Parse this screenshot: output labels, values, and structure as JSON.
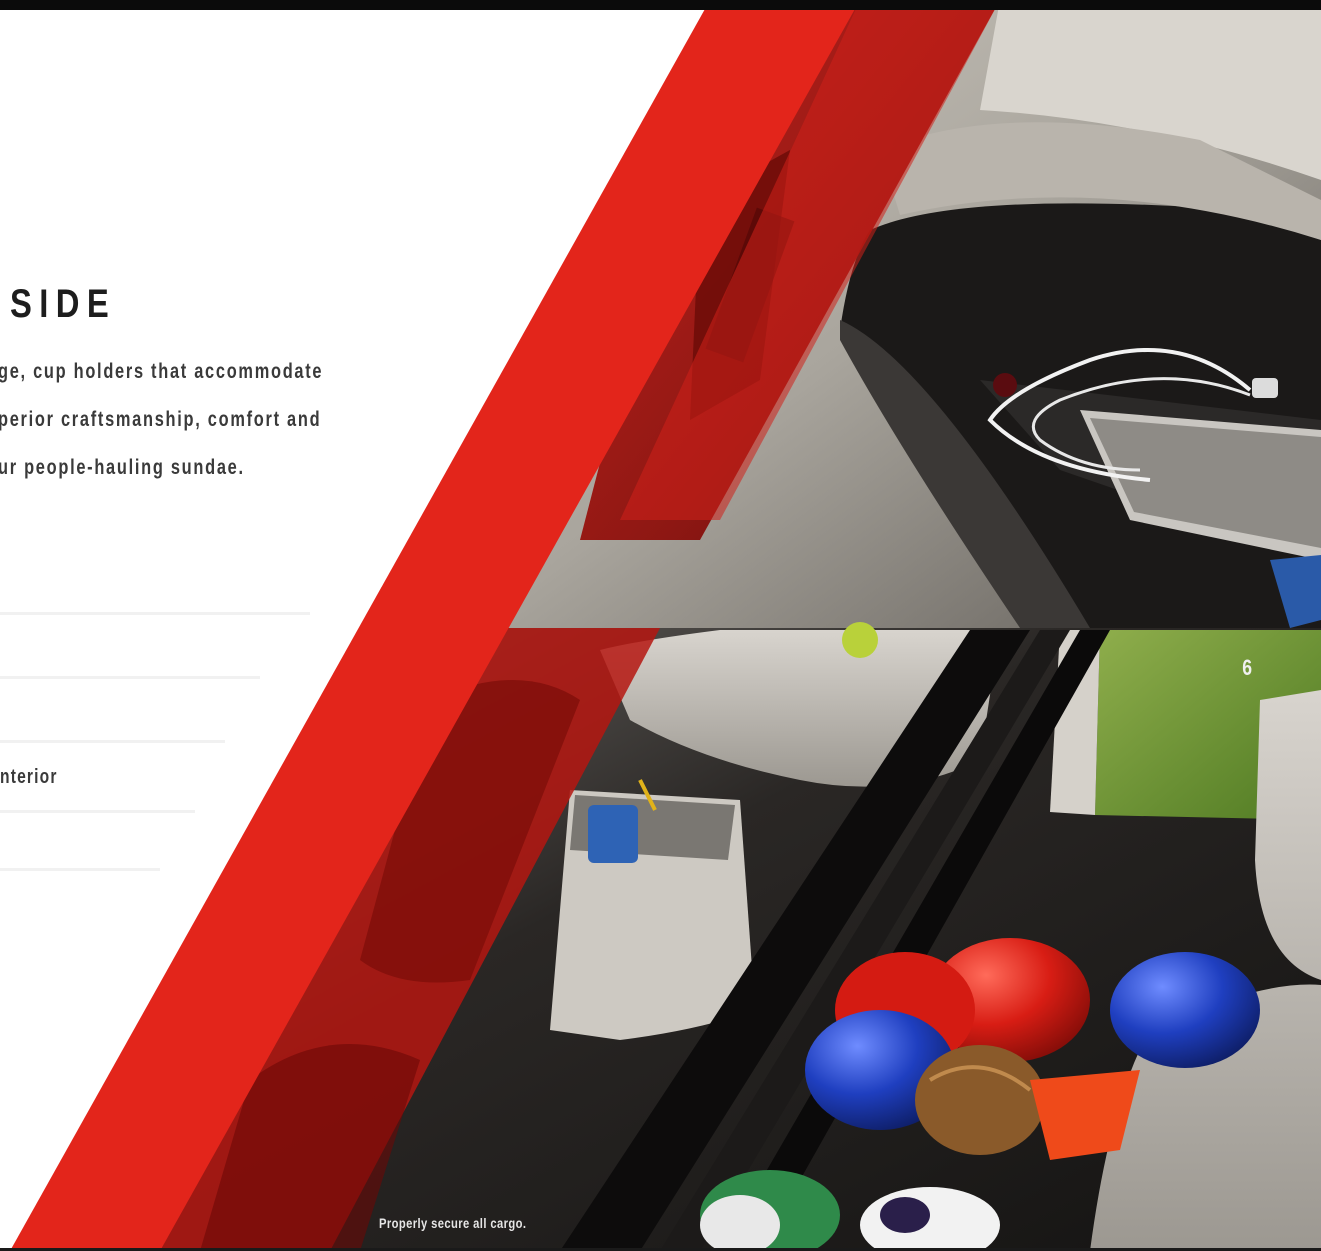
{
  "heading": "SIDE",
  "body_lines": [
    "ge, cup holders that accommodate",
    "perior craftsmanship, comfort and",
    "ur people-hauling sundae."
  ],
  "caption": "nterior",
  "page_number": "6",
  "disclaimer": "Properly secure all cargo.",
  "colors": {
    "accent_red": "#e3251b",
    "dark_red": "#7a0f0c",
    "text": "#2b2b2b"
  },
  "photos": [
    {
      "name": "overhead-console-photo",
      "icon": "usb-cable-tray"
    },
    {
      "name": "rear-storage-photo",
      "icon": "sports-equipment-bin"
    }
  ]
}
